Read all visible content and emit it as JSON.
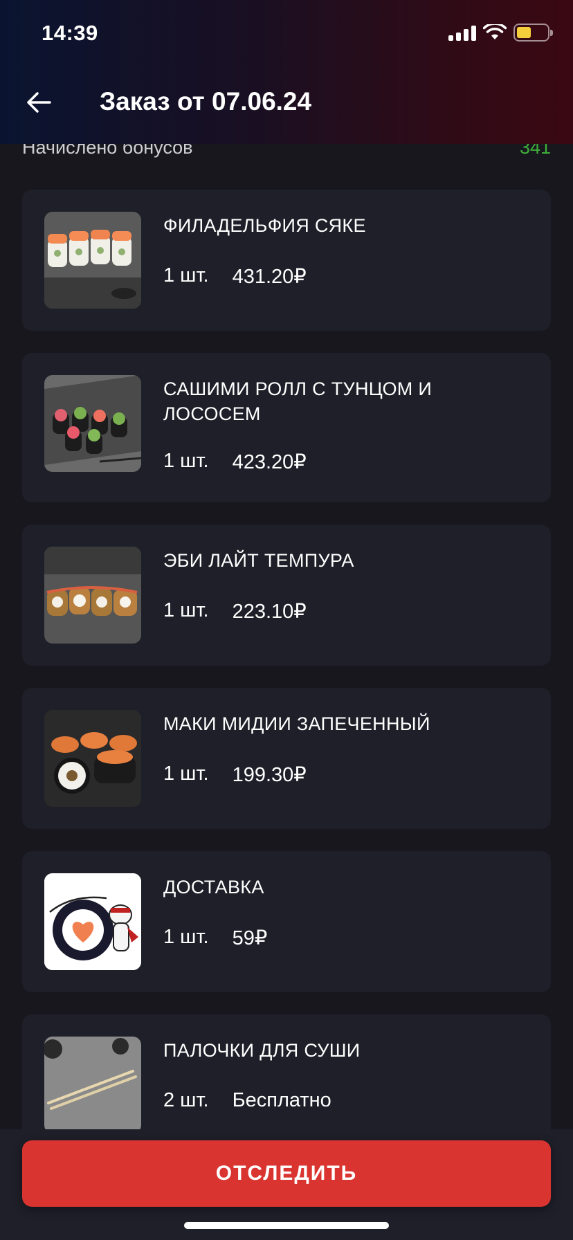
{
  "status_bar": {
    "time": "14:39"
  },
  "header": {
    "title": "Заказ от 07.06.24"
  },
  "bonus": {
    "label": "Начислено бонусов",
    "value": "341"
  },
  "items": [
    {
      "name": "ФИЛАДЕЛЬФИЯ СЯКЕ",
      "qty": "1 шт.",
      "price": "431.20₽",
      "image": "sushi-roll-philadelphia"
    },
    {
      "name": "САШИМИ РОЛЛ С ТУНЦОМ И ЛОСОСЕМ",
      "qty": "1 шт.",
      "price": "423.20₽",
      "image": "sushi-roll-sashimi"
    },
    {
      "name": "ЭБИ ЛАЙТ ТЕМПУРА",
      "qty": "1 шт.",
      "price": "223.10₽",
      "image": "sushi-roll-tempura"
    },
    {
      "name": "МАКИ МИДИИ ЗАПЕЧЕННЫЙ",
      "qty": "1 шт.",
      "price": "199.30₽",
      "image": "sushi-roll-baked"
    },
    {
      "name": "ДОСТАВКА",
      "qty": "1 шт.",
      "price": "59₽",
      "image": "delivery-logo"
    },
    {
      "name": "ПАЛОЧКИ ДЛЯ СУШИ",
      "qty": "2 шт.",
      "price": "Бесплатно",
      "image": "chopsticks"
    }
  ],
  "actions": {
    "track_label": "ОТСЛЕДИТЬ"
  },
  "colors": {
    "accent": "#d9342f",
    "bonus": "#3fae3a",
    "card": "#1f1f29",
    "background": "#17171d"
  },
  "icons": {
    "back": "arrow-left-icon",
    "signal": "cellular-signal-icon",
    "wifi": "wifi-icon",
    "battery": "battery-icon"
  }
}
